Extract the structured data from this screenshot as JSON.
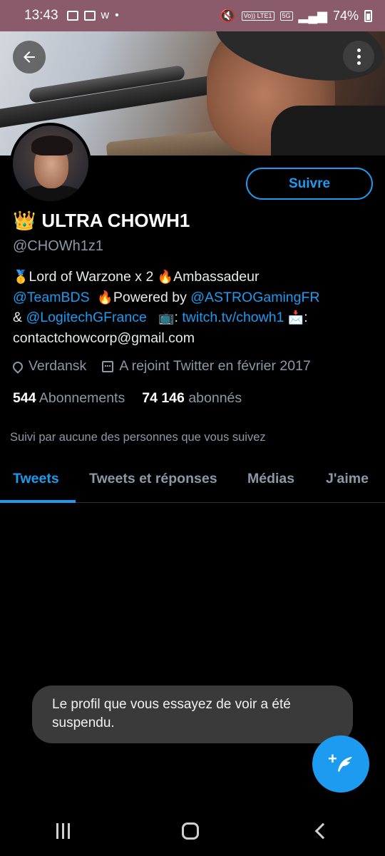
{
  "status_bar": {
    "time": "13:43",
    "battery": "74%",
    "network_badge_1": "Vo)) LTE1",
    "network_badge_2": "5G"
  },
  "profile": {
    "crown_emoji": "👑",
    "name": "ULTRA CHOWH1",
    "handle": "@CHOWh1z1",
    "follow_label": "Suivre",
    "bio": {
      "medal": "🥇",
      "t1": "Lord of Warzone x 2 ",
      "fire1": "🔥",
      "t2": "Ambassadeur",
      "link_teambds": "@TeamBDS",
      "fire2": "🔥",
      "t3": "Powered by ",
      "link_astro": "@ASTROGamingFR",
      "amp": "& ",
      "link_logitech": "@LogitechGFrance",
      "tv": "📺",
      "colon1": ": ",
      "link_twitch": "twitch.tv/chowh1",
      "mail": "📩",
      "colon2": ":",
      "email": "contactchowcorp@gmail.com"
    },
    "location": "Verdansk",
    "joined": "A rejoint Twitter en février 2017",
    "following_count": "544",
    "following_label": "Abonnements",
    "followers_count": "74 146",
    "followers_label": "abonnés",
    "followed_by": "Suivi par aucune des personnes que vous suivez"
  },
  "tabs": [
    {
      "label": "Tweets"
    },
    {
      "label": "Tweets et réponses"
    },
    {
      "label": "Médias"
    },
    {
      "label": "J'aime"
    }
  ],
  "active_tab": "Tweets",
  "toast": "Le profil que vous essayez de voir a été suspendu.",
  "colors": {
    "accent": "#1d9bf0",
    "background": "#000000",
    "muted_text": "#8b98a5",
    "status_bar": "#8a5b6a"
  },
  "icons": {
    "back": "arrow-left-icon",
    "more": "more-vertical-icon",
    "location": "location-pin-icon",
    "calendar": "calendar-icon",
    "compose": "compose-feather-icon"
  }
}
